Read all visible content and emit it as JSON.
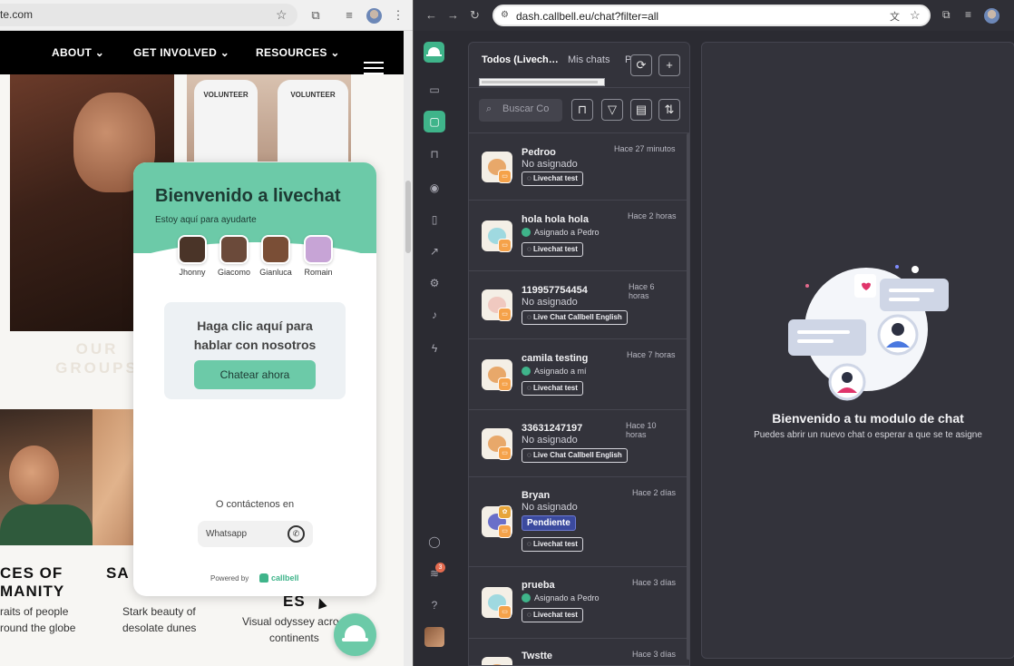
{
  "left_browser": {
    "url": "te.com"
  },
  "site": {
    "nav": [
      "ABOUT",
      "GET INVOLVED",
      "RESOURCES"
    ],
    "shirt_text": "VOLUNTEER",
    "section": "OUR GROUPS",
    "captions": [
      {
        "title_line1": "CES OF",
        "title_line2": "MANITY",
        "text_line1": "raits of people",
        "text_line2": "round the globe"
      },
      {
        "title_line1": "SA",
        "title_line2": "",
        "text_line1": "Stark beauty of",
        "text_line2": "desolate dunes"
      },
      {
        "title_line1": "ES",
        "title_line2": "",
        "text_line1": "Visual odyssey acro",
        "text_line2": "continents"
      }
    ]
  },
  "widget": {
    "title": "Bienvenido a livechat",
    "subtitle": "Estoy aquí para ayudarte",
    "agents": [
      {
        "name": "Jhonny",
        "color": "#4a3428"
      },
      {
        "name": "Giacomo",
        "color": "#6b4a3a"
      },
      {
        "name": "Gianluca",
        "color": "#7a4e36"
      },
      {
        "name": "Romain",
        "color": "#c7a4d6"
      }
    ],
    "card_text_line1": "Haga clic aquí para",
    "card_text_line2": "hablar con nosotros",
    "cta": "Chatear ahora",
    "contact_label": "O contáctenos en",
    "whatsapp": "Whatsapp",
    "powered_by": "Powered by",
    "brand": "callbell",
    "accent": "#6ccaa8"
  },
  "right_browser": {
    "url": "dash.callbell.eu/chat?filter=all"
  },
  "chats_panel": {
    "tabs": [
      "Todos (Livech…",
      "Mis chats",
      "P"
    ],
    "search_placeholder": "Buscar Co",
    "chats": [
      {
        "name": "Pedroo",
        "status": "No asignado",
        "assigned": false,
        "tag": "Livechat test",
        "time_line1": "Hace 27 minutos",
        "time_line2": "",
        "avatar_color": "#e8a86a",
        "pending": ""
      },
      {
        "name": "hola hola hola",
        "status": "Asignado a Pedro",
        "assigned": true,
        "tag": "Livechat test",
        "time_line1": "Hace 2 horas",
        "time_line2": "",
        "avatar_color": "#9fd9e0",
        "pending": ""
      },
      {
        "name": "119957754454",
        "status": "No asignado",
        "assigned": false,
        "tag": "Live Chat Callbell English",
        "time_line1": "Hace 6",
        "time_line2": "horas",
        "avatar_color": "#f0c9c0",
        "pending": ""
      },
      {
        "name": "camila testing",
        "status": "Asignado a mí",
        "assigned": true,
        "tag": "Livechat test",
        "time_line1": "Hace 7 horas",
        "time_line2": "",
        "avatar_color": "#e8a86a",
        "pending": ""
      },
      {
        "name": "33631247197",
        "status": "No asignado",
        "assigned": false,
        "tag": "Live Chat Callbell English",
        "time_line1": "Hace 10",
        "time_line2": "horas",
        "avatar_color": "#e8a86a",
        "pending": ""
      },
      {
        "name": "Bryan",
        "status": "No asignado",
        "assigned": false,
        "tag": "Livechat test",
        "time_line1": "Hace 2 días",
        "time_line2": "",
        "avatar_color": "#6a6fc9",
        "pending": "Pendiente"
      },
      {
        "name": "prueba",
        "status": "Asignado a Pedro",
        "assigned": true,
        "tag": "Livechat test",
        "time_line1": "Hace 3 días",
        "time_line2": "",
        "avatar_color": "#9fd9e0",
        "pending": ""
      },
      {
        "name": "Twstte",
        "status": "",
        "assigned": false,
        "tag": "",
        "time_line1": "Hace 3 días",
        "time_line2": "",
        "avatar_color": "#e8a86a",
        "pending": ""
      }
    ]
  },
  "empty_state": {
    "title": "Bienvenido a tu modulo de chat",
    "subtitle": "Puedes abrir un nuevo chat o esperar a que se te asigne"
  },
  "rail": {
    "badge": "3"
  },
  "colors": {
    "brand_green": "#3fb48a",
    "dark_bg": "#2b2b32",
    "panel_bg": "#33333b"
  }
}
